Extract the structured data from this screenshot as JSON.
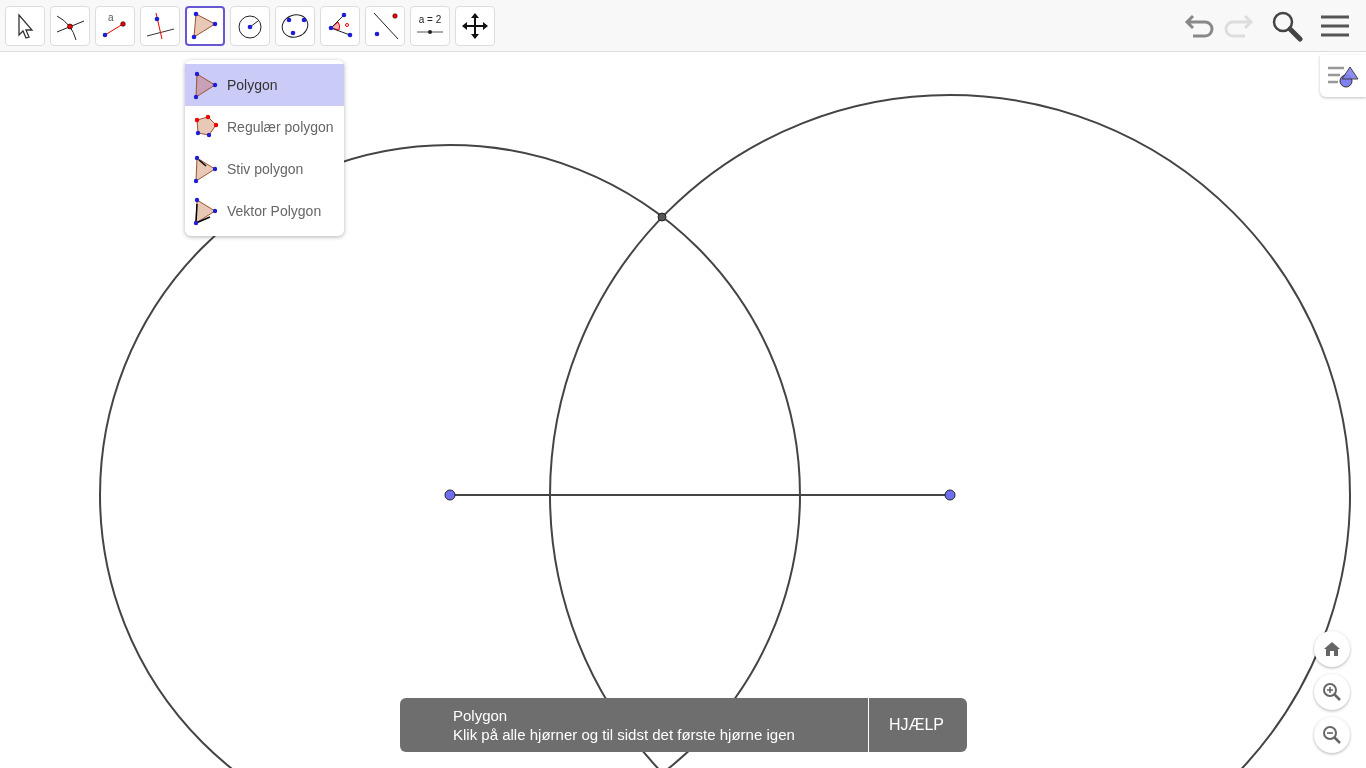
{
  "toolbar": {
    "tools": [
      {
        "kind": "move",
        "selected": false
      },
      {
        "kind": "intersect",
        "selected": false
      },
      {
        "kind": "segment",
        "label": "a",
        "selected": false
      },
      {
        "kind": "perpendicular",
        "selected": false
      },
      {
        "kind": "polygon",
        "selected": true
      },
      {
        "kind": "circle",
        "selected": false
      },
      {
        "kind": "conic",
        "selected": false
      },
      {
        "kind": "angle",
        "selected": false
      },
      {
        "kind": "reflect",
        "selected": false
      },
      {
        "kind": "slider",
        "label": "a = 2",
        "selected": false
      },
      {
        "kind": "pan",
        "selected": false
      }
    ],
    "undo": {
      "disabled": false
    },
    "redo": {
      "disabled": true
    }
  },
  "tool_menu": {
    "items": [
      {
        "kind": "polygon",
        "label": "Polygon",
        "selected": true
      },
      {
        "kind": "regular",
        "label": "Regulær polygon",
        "selected": false
      },
      {
        "kind": "rigid",
        "label": "Stiv polygon",
        "selected": false
      },
      {
        "kind": "vector",
        "label": "Vektor Polygon",
        "selected": false
      }
    ]
  },
  "tooltip": {
    "title": "Polygon",
    "text": "Klik på alle hjørner og til sidst det første hjørne igen",
    "help_button": "HJÆLP"
  }
}
